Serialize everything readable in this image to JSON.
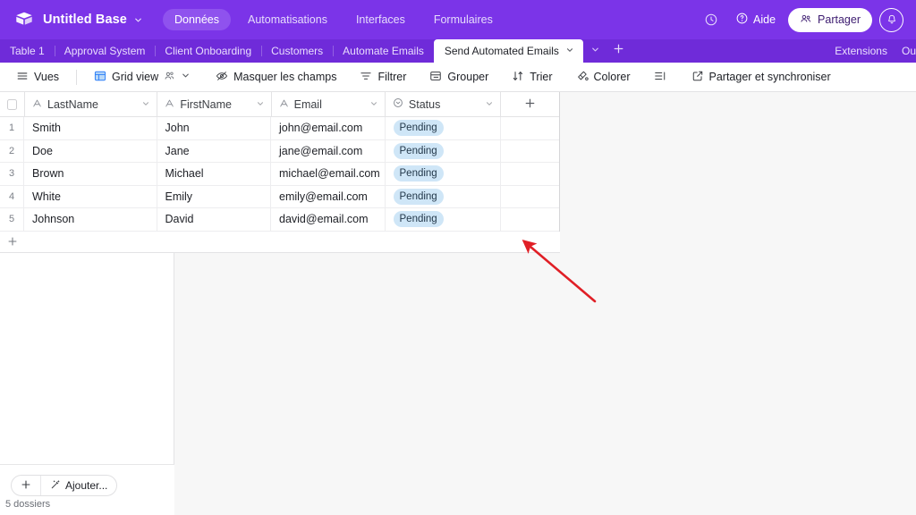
{
  "header": {
    "logo_icon": "airtable-cube-icon",
    "base_title": "Untitled Base",
    "title_caret_icon": "chevron-down-icon",
    "nav": [
      {
        "label": "Données",
        "active": true
      },
      {
        "label": "Automatisations",
        "active": false
      },
      {
        "label": "Interfaces",
        "active": false
      },
      {
        "label": "Formulaires",
        "active": false
      }
    ],
    "history_icon": "history-clock-icon",
    "help_icon": "help-circle-icon",
    "help_label": "Aide",
    "share_icon": "people-share-icon",
    "share_label": "Partager",
    "notification_icon": "bell-icon",
    "bg_color": "#7b34e8"
  },
  "tabbar": {
    "tabs": [
      {
        "label": "Table 1",
        "active": false
      },
      {
        "label": "Approval System",
        "active": false
      },
      {
        "label": "Client Onboarding",
        "active": false
      },
      {
        "label": "Customers",
        "active": false
      },
      {
        "label": "Automate Emails",
        "active": false
      },
      {
        "label": "Send Automated Emails",
        "active": true
      }
    ],
    "active_tab_caret_icon": "chevron-down-icon",
    "overflow_caret_icon": "chevron-down-icon",
    "add_table_icon": "plus-icon",
    "extensions_label": "Extensions",
    "tools_label": "Ou",
    "bg_color": "#6f2bd9"
  },
  "toolbar": {
    "views_icon": "hamburger-icon",
    "views_label": "Vues",
    "grid_view_icon": "grid-icon",
    "grid_view_label": "Grid view",
    "collaborators_icon": "collaborators-icon",
    "grid_view_caret_icon": "chevron-down-icon",
    "hide_fields_icon": "eye-slash-icon",
    "hide_fields_label": "Masquer les champs",
    "filter_icon": "filter-icon",
    "filter_label": "Filtrer",
    "group_icon": "group-icon",
    "group_label": "Grouper",
    "sort_icon": "sort-icon",
    "sort_label": "Trier",
    "color_icon": "paint-icon",
    "color_label": "Colorer",
    "row_height_icon": "row-height-icon",
    "share_sync_icon": "external-link-icon",
    "share_sync_label": "Partager et synchroniser"
  },
  "grid": {
    "select_all_icon": "checkbox-icon",
    "columns": [
      {
        "label": "LastName",
        "type_icon": "text-field-icon",
        "caret_icon": "chevron-down-icon"
      },
      {
        "label": "FirstName",
        "type_icon": "text-field-icon",
        "caret_icon": "chevron-down-icon"
      },
      {
        "label": "Email",
        "type_icon": "text-field-icon",
        "caret_icon": "chevron-down-icon"
      },
      {
        "label": "Status",
        "type_icon": "single-select-icon",
        "caret_icon": "chevron-down-icon"
      }
    ],
    "add_field_icon": "plus-icon",
    "rows": [
      {
        "num": "1",
        "LastName": "Smith",
        "FirstName": "John",
        "Email": "john@email.com",
        "Status": "Pending"
      },
      {
        "num": "2",
        "LastName": "Doe",
        "FirstName": "Jane",
        "Email": "jane@email.com",
        "Status": "Pending"
      },
      {
        "num": "3",
        "LastName": "Brown",
        "FirstName": "Michael",
        "Email": "michael@email.com",
        "Status": "Pending"
      },
      {
        "num": "4",
        "LastName": "White",
        "FirstName": "Emily",
        "Email": "emily@email.com",
        "Status": "Pending"
      },
      {
        "num": "5",
        "LastName": "Johnson",
        "FirstName": "David",
        "Email": "david@email.com",
        "Status": "Pending"
      }
    ],
    "add_row_icon": "plus-icon",
    "badge_color": "#cfe6f7"
  },
  "footer": {
    "add_record_icon": "plus-icon",
    "magic_icon": "magic-wand-icon",
    "add_label": "Ajouter...",
    "record_count": "5 dossiers"
  },
  "annotation": {
    "arrow_icon": "red-arrow-icon",
    "color": "#e01f26"
  }
}
